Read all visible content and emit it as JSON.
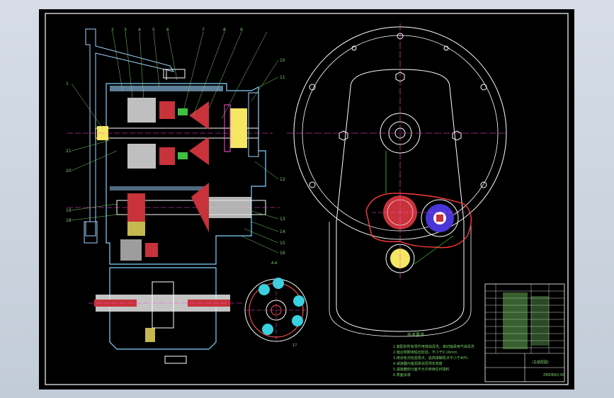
{
  "drawing": {
    "part_labels_top": [
      "2",
      "3",
      "4",
      "5",
      "6",
      "7",
      "8",
      "9"
    ],
    "part_labels_right": [
      "10",
      "11",
      "12",
      "13",
      "14",
      "15",
      "16"
    ],
    "part_labels_left": [
      "1",
      "21",
      "20",
      "19",
      "18"
    ],
    "part_label_bottom": "17",
    "section_label": "A-A",
    "notes_title": "技术要求",
    "notes_lines": [
      "1.装配前所有零件用煤油清洗，滚动轴承用汽油清洗",
      "2.啮合侧隙用铅丝检验，不小于0.16mm",
      "3.用涂色法检验斑点，齿高接触斑点不小于40%",
      "4.减速器内装润滑油至规定高度",
      "5.减速器剖分面不允许使用任何填料",
      "6.表面涂漆"
    ],
    "title_block": {
      "drawing_title": "(总装配图)",
      "drawing_number": "ZMDBSQ-00"
    }
  }
}
